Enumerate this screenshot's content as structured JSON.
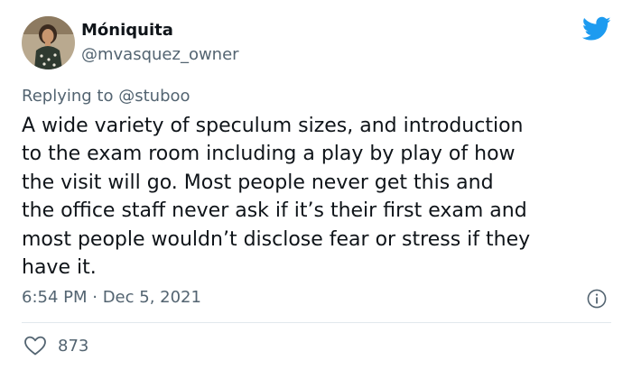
{
  "author": {
    "display_name": "Móniquita",
    "handle": "@mvasquez_owner",
    "avatar_icon": "profile-photo"
  },
  "brand": {
    "icon": "twitter-bird-icon",
    "color": "#1d9bf0"
  },
  "reply": {
    "prefix": "Replying to",
    "to": "@stuboo"
  },
  "tweet": {
    "text": "A wide variety of speculum sizes, and introduction\nto the exam room including a play by play of how\nthe visit will go. Most people never get this and\nthe office staff never ask if it’s their first exam and\nmost people wouldn’t disclose fear or stress if they\nhave it."
  },
  "meta": {
    "timestamp": "6:54 PM · Dec 5, 2021",
    "info_icon": "info-icon"
  },
  "engagement": {
    "like_icon": "heart-icon",
    "likes": "873"
  },
  "colors": {
    "text_primary": "#0f1419",
    "text_secondary": "#536471",
    "divider": "#e1e8ed"
  }
}
